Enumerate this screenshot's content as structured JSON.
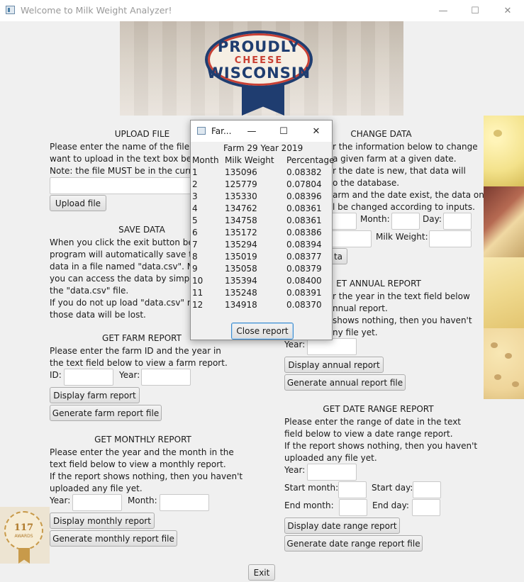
{
  "window": {
    "title": "Welcome to Milk Weight Analyzer!",
    "min": "—",
    "max": "☐",
    "close": "✕"
  },
  "banner": {
    "line1": "PROUDLY",
    "line2": "CHEESE",
    "line3": "WISCONSIN"
  },
  "upload": {
    "title": "UPLOAD FILE",
    "lines": [
      "Please enter the name of the file th",
      "want to upload in the text box belo",
      "Note: the file MUST be in the curre"
    ],
    "button": "Upload file"
  },
  "save": {
    "title": "SAVE DATA",
    "lines": [
      "When you click the exit button bel",
      "program will automatically save th",
      "data in a file named \"data.csv\". Ne",
      "you can access the data by simply",
      "the \"data.csv\" file.",
      "If you do not up load \"data.csv\" ne",
      "those data will be lost."
    ]
  },
  "farm_report": {
    "title": "GET FARM REPORT",
    "lines": [
      "Please enter the farm ID and the year in",
      "the text field below to view a farm report."
    ],
    "id_label": "ID:",
    "year_label": "Year:",
    "display_button": "Display farm report",
    "generate_button": "Generate farm report file"
  },
  "monthly_report": {
    "title": "GET MONTHLY REPORT",
    "lines": [
      "Please enter the year and the month in the",
      "text field below to view a monthly report.",
      "If the report shows nothing, then you haven't",
      "uploaded any file yet."
    ],
    "year_label": "Year:",
    "month_label": "Month:",
    "display_button": "Display monthly report",
    "generate_button": "Generate monthly report file"
  },
  "change_data": {
    "title": "CHANGE DATA",
    "lines": [
      "r the information below to change",
      "a given farm at a given date.",
      "r the date is new, that data will",
      "o the database.",
      "arm and the date exist, the data on",
      "l be changed according to inputs."
    ],
    "month_label": "Month:",
    "day_label": "Day:",
    "milk_label": "Milk Weight:",
    "button_partial": "ta"
  },
  "annual_report": {
    "title": "ET ANNUAL REPORT",
    "lines": [
      "r the year in the text field below",
      "nnual report.",
      "shows nothing, then you haven't",
      "ny file yet."
    ],
    "year_label": "Year:",
    "display_button": "Display annual report",
    "generate_button": "Generate annual report file"
  },
  "date_range": {
    "title": "GET DATE RANGE REPORT",
    "lines": [
      "Please enter the range of date in the text",
      "field below to view a date range report.",
      "If the report shows nothing, then you haven't",
      "uploaded any file yet."
    ],
    "year_label": "Year:",
    "start_month_label": "Start month:",
    "start_day_label": "Start day:",
    "end_month_label": "End month:",
    "end_day_label": "End day:",
    "display_button": "Display date range report",
    "generate_button": "Generate date range report file"
  },
  "exit_button": "Exit",
  "medal": {
    "number": "117",
    "text": "AWARDS"
  },
  "popup": {
    "title": "Far...",
    "min": "—",
    "max": "☐",
    "close": "✕",
    "header": "Farm 29  Year 2019",
    "col_month": "Month",
    "col_weight": "Milk Weight",
    "col_pct": "Percentage",
    "rows": [
      {
        "month": "1",
        "weight": "135096",
        "pct": "0.08382"
      },
      {
        "month": "2",
        "weight": "125779",
        "pct": "0.07804"
      },
      {
        "month": "3",
        "weight": "135330",
        "pct": "0.08396"
      },
      {
        "month": "4",
        "weight": "134762",
        "pct": "0.08361"
      },
      {
        "month": "5",
        "weight": "134758",
        "pct": "0.08361"
      },
      {
        "month": "6",
        "weight": "135172",
        "pct": "0.08386"
      },
      {
        "month": "7",
        "weight": "135294",
        "pct": "0.08394"
      },
      {
        "month": "8",
        "weight": "135019",
        "pct": "0.08377"
      },
      {
        "month": "9",
        "weight": "135058",
        "pct": "0.08379"
      },
      {
        "month": "10",
        "weight": "135394",
        "pct": "0.08400"
      },
      {
        "month": "11",
        "weight": "135248",
        "pct": "0.08391"
      },
      {
        "month": "12",
        "weight": "134918",
        "pct": "0.08370"
      }
    ],
    "close_button": "Close report"
  }
}
